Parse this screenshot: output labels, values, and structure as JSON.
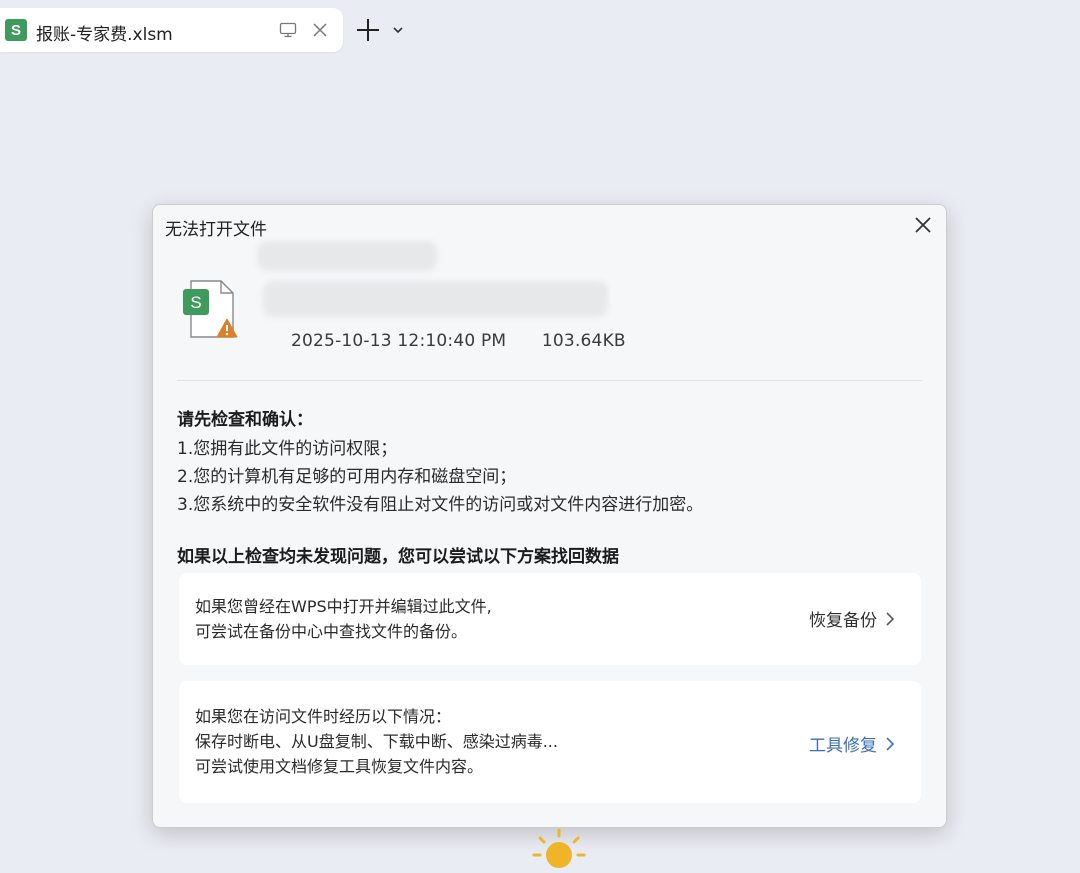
{
  "tab": {
    "icon_letter": "S",
    "title": "报账-专家费.xlsm",
    "monitor_icon": "monitor-icon",
    "close_icon": "close-icon"
  },
  "tabbar": {
    "new_tab_icon": "plus-icon",
    "dropdown_icon": "chevron-down-icon"
  },
  "dialog": {
    "title": "无法打开文件",
    "file": {
      "icon_letter": "S",
      "date": "2025-10-13",
      "time": "12:10:40 PM",
      "size": "103.64KB"
    },
    "check": {
      "title": "请先检查和确认：",
      "items": [
        "1.您拥有此文件的访问权限；",
        "2.您的计算机有足够的可用内存和磁盘空间；",
        "3.您系统中的安全软件没有阻止对文件的访问或对文件内容进行加密。"
      ]
    },
    "recover_title": "如果以上检查均未发现问题，您可以尝试以下方案找回数据",
    "cards": [
      {
        "lines": [
          "如果您曾经在WPS中打开并编辑过此文件,",
          "可尝试在备份中心中查找文件的备份。"
        ],
        "action": "恢复备份"
      },
      {
        "lines": [
          "如果您在访问文件时经历以下情况：",
          "保存时断电、从U盘复制、下载中断、感染过病毒...",
          "可尝试使用文档修复工具恢复文件内容。"
        ],
        "action": "工具修复"
      }
    ]
  },
  "colors": {
    "spreadsheet_green": "#3f9b5d",
    "warning_orange": "#d9822b",
    "link_blue": "#3a6fb8",
    "sun_yellow": "#f0b429"
  }
}
